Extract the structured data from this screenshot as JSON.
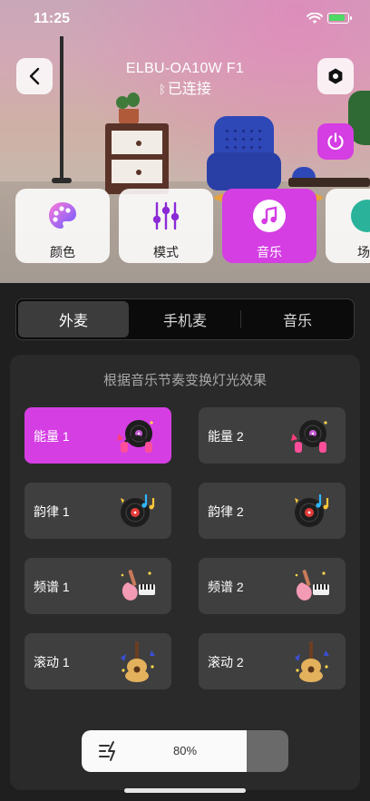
{
  "status_bar": {
    "time": "11:25"
  },
  "device": {
    "name": "ELBU-OA10W  F1",
    "connection_status": "已连接"
  },
  "feature_tabs": [
    {
      "label": "颜色",
      "icon": "palette-icon",
      "active": false
    },
    {
      "label": "模式",
      "icon": "sliders-icon",
      "active": false
    },
    {
      "label": "音乐",
      "icon": "music-note-icon",
      "active": true
    },
    {
      "label": "场",
      "icon": "scene-icon",
      "active": false
    }
  ],
  "mic_tabs": [
    {
      "label": "外麦",
      "active": true
    },
    {
      "label": "手机麦",
      "active": false
    },
    {
      "label": "音乐",
      "active": false
    }
  ],
  "effects_panel": {
    "title": "根据音乐节奏变换灯光效果",
    "effects": [
      {
        "label": "能量 1",
        "icon": "vinyl-headphones-icon",
        "active": true
      },
      {
        "label": "能量 2",
        "icon": "vinyl-headphones-icon",
        "active": false
      },
      {
        "label": "韵律 1",
        "icon": "vinyl-notes-icon",
        "active": false
      },
      {
        "label": "韵律 2",
        "icon": "vinyl-notes-icon",
        "active": false
      },
      {
        "label": "频谱 1",
        "icon": "guitar-keyboard-icon",
        "active": false
      },
      {
        "label": "频谱 2",
        "icon": "guitar-keyboard-icon",
        "active": false
      },
      {
        "label": "滚动 1",
        "icon": "ukulele-icon",
        "active": false
      },
      {
        "label": "滚动 2",
        "icon": "ukulele-icon",
        "active": false
      }
    ]
  },
  "brightness": {
    "label": "80%",
    "value": 0.8
  },
  "colors": {
    "accent": "#d43ee3",
    "panel": "#2a2a2a",
    "tile": "#3f3f3f"
  }
}
